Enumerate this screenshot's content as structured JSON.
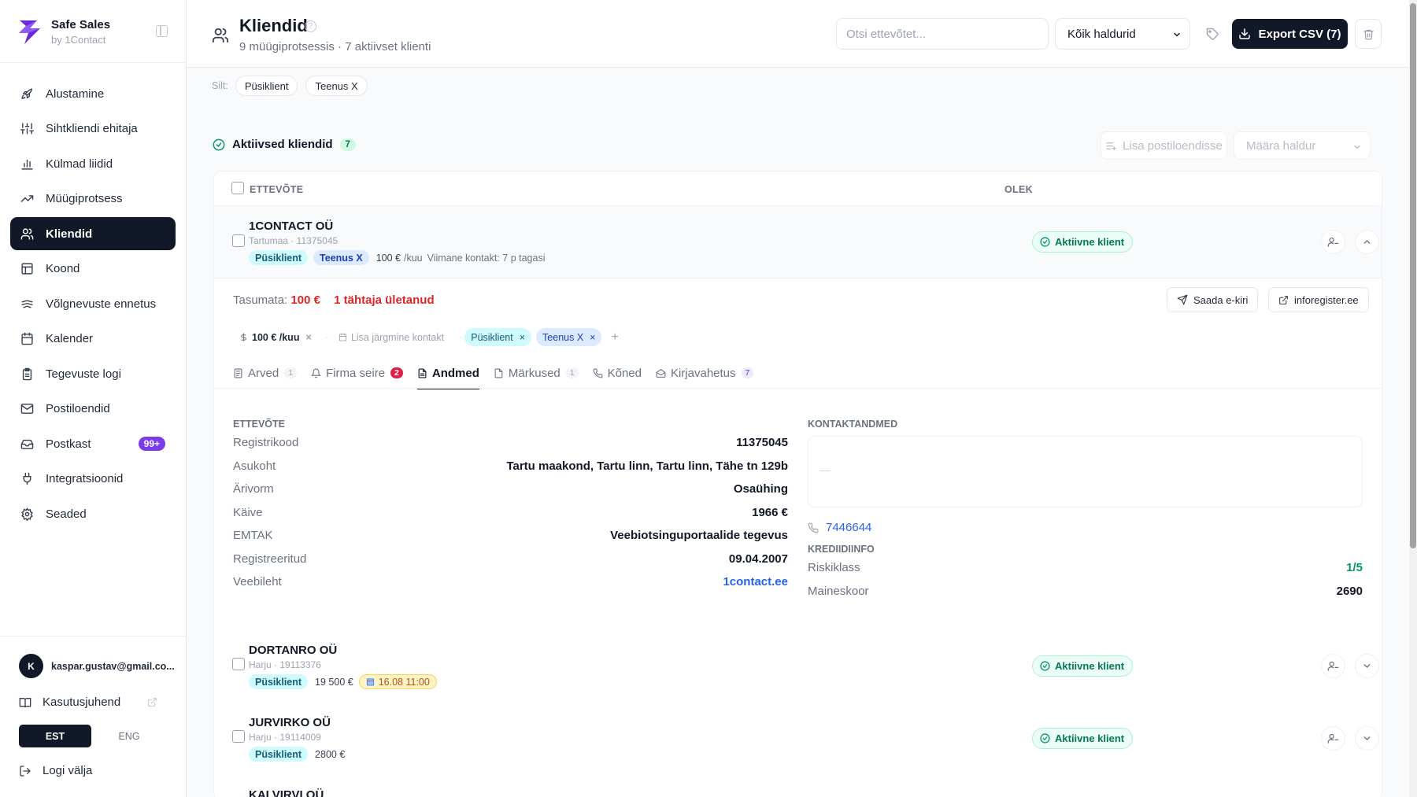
{
  "app": {
    "name": "Safe Sales",
    "by": "by 1Contact"
  },
  "sidebar": {
    "items": [
      {
        "label": "Alustamine",
        "icon": "rocket-icon"
      },
      {
        "label": "Sihtkliendi ehitaja",
        "icon": "sliders-icon"
      },
      {
        "label": "Külmad liidid",
        "icon": "bar-chart-icon"
      },
      {
        "label": "Müügiprotsess",
        "icon": "trending-up-icon"
      },
      {
        "label": "Kliendid",
        "icon": "users-icon",
        "active": true
      },
      {
        "label": "Koond",
        "icon": "table-icon"
      },
      {
        "label": "Võlgnevuste ennetus",
        "icon": "shield-icon"
      },
      {
        "label": "Kalender",
        "icon": "calendar-icon"
      },
      {
        "label": "Tegevuste logi",
        "icon": "clipboard-icon"
      },
      {
        "label": "Postiloendid",
        "icon": "mail-icon"
      },
      {
        "label": "Postkast",
        "icon": "inbox-icon",
        "badge": "99+"
      },
      {
        "label": "Integratsioonid",
        "icon": "plug-icon"
      },
      {
        "label": "Seaded",
        "icon": "gear-icon"
      }
    ],
    "user": {
      "initial": "K",
      "email": "kaspar.gustav@gmail.co..."
    },
    "guide_label": "Kasutusjuhend",
    "lang": {
      "est": "EST",
      "eng": "ENG"
    },
    "logout_label": "Logi välja"
  },
  "header": {
    "title": "Kliendid",
    "subtitle": "9 müügiprotsessis · 7 aktiivset klienti",
    "search_placeholder": "Otsi ettevõtet...",
    "manager_select": "Kõik haldurid",
    "export_label": "Export CSV (7)"
  },
  "filters": {
    "label": "Silt:",
    "chips": [
      "Püsiklient",
      "Teenus X"
    ]
  },
  "section": {
    "title": "Aktiivsed kliendid",
    "count": "7",
    "add_mailing": "Lisa postiloendisse",
    "assign_manager": "Määra haldur"
  },
  "table": {
    "headers": {
      "company": "ETTEVÕTE",
      "status": "OLEK"
    },
    "rows": [
      {
        "name": "1CONTACT OÜ",
        "meta": "Tartumaa · 11375045",
        "tags": [
          "Püsiklient",
          "Teenus X"
        ],
        "amount": "100 €",
        "amount_unit": "/kuu",
        "last_contact": "Viimane kontakt: 7 p tagasi",
        "status": "Aktiivne klient"
      },
      {
        "name": "DORTANRO OÜ",
        "meta": "Harju · 19113376",
        "tag": "Püsiklient",
        "amount": "19 500 €",
        "date": "16.08 11:00",
        "status": "Aktiivne klient"
      },
      {
        "name": "JURVIRKO OÜ",
        "meta": "Harju · 19114009",
        "tag": "Püsiklient",
        "amount": "2800 €",
        "status": "Aktiivne klient"
      },
      {
        "name": "KALVIRVI OÜ"
      }
    ]
  },
  "detail": {
    "owed_label": "Tasumata:",
    "owed_value": "100 €",
    "overdue": "1 tähtaja ületanud",
    "send_email": "Saada e-kiri",
    "inforegister": "inforegister.ee",
    "chips": {
      "price": "100 € /kuu",
      "next_contact": "Lisa järgmine kontakt",
      "tag1": "Püsiklient",
      "tag2": "Teenus X",
      "add": "+"
    },
    "tabs": [
      {
        "label": "Arved",
        "count": "1"
      },
      {
        "label": "Firma seire",
        "count": "2"
      },
      {
        "label": "Andmed"
      },
      {
        "label": "Märkused",
        "count": "1"
      },
      {
        "label": "Kõned"
      },
      {
        "label": "Kirjavahetus",
        "count": "7"
      }
    ],
    "company_title": "ETTEVÕTE",
    "company": [
      {
        "k": "Registrikood",
        "v": "11375045"
      },
      {
        "k": "Asukoht",
        "v": "Tartu maakond, Tartu linn, Tartu linn, Tähe tn 129b"
      },
      {
        "k": "Ärivorm",
        "v": "Osaühing"
      },
      {
        "k": "Käive",
        "v": "1966 €"
      },
      {
        "k": "EMTAK",
        "v": "Veebiotsinguportaalide tegevus"
      },
      {
        "k": "Registreeritud",
        "v": "09.04.2007"
      },
      {
        "k": "Veebileht",
        "v": "1contact.ee"
      }
    ],
    "contact_title": "KONTAKTANDMED",
    "contact_placeholder": "—",
    "phone": "7446644",
    "credit_title": "KREDIIDIINFO",
    "credit": [
      {
        "k": "Riskiklass",
        "v": "1/5"
      },
      {
        "k": "Maineskoor",
        "v": "2690"
      }
    ]
  },
  "colors": {
    "accent": "#111827",
    "brand": "#7c3aed",
    "status_green": "#047857",
    "danger": "#dc2626",
    "link": "#2563eb"
  }
}
